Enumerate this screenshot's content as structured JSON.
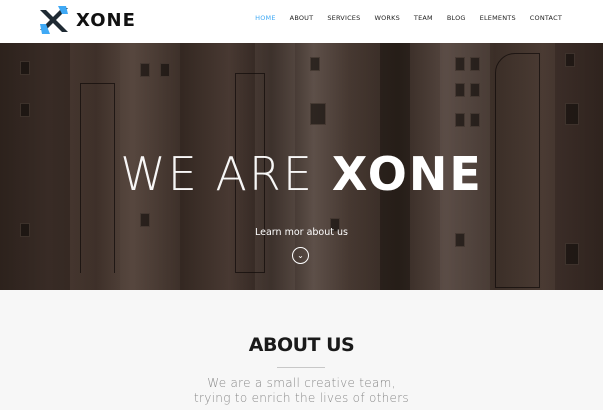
{
  "brand": {
    "name": "XONE"
  },
  "nav": {
    "items": [
      {
        "label": "HOME",
        "active": true
      },
      {
        "label": "ABOUT",
        "active": false
      },
      {
        "label": "SERVICES",
        "active": false
      },
      {
        "label": "WORKS",
        "active": false
      },
      {
        "label": "TEAM",
        "active": false
      },
      {
        "label": "BLOG",
        "active": false
      },
      {
        "label": "ELEMENTS",
        "active": false
      },
      {
        "label": "CONTACT",
        "active": false
      }
    ]
  },
  "hero": {
    "title_thin": "WE ARE",
    "title_bold": "XONE",
    "link_label": "Learn mor about us",
    "down_icon": "chevron-down-icon"
  },
  "about": {
    "title": "ABOUT US",
    "text_line1": "We are a small creative team,",
    "text_line2": "trying to enrich the lives of others"
  },
  "colors": {
    "accent": "#3fa9f5",
    "logo_dark": "#1f2a33",
    "logo_blue": "#3fa9f5"
  }
}
